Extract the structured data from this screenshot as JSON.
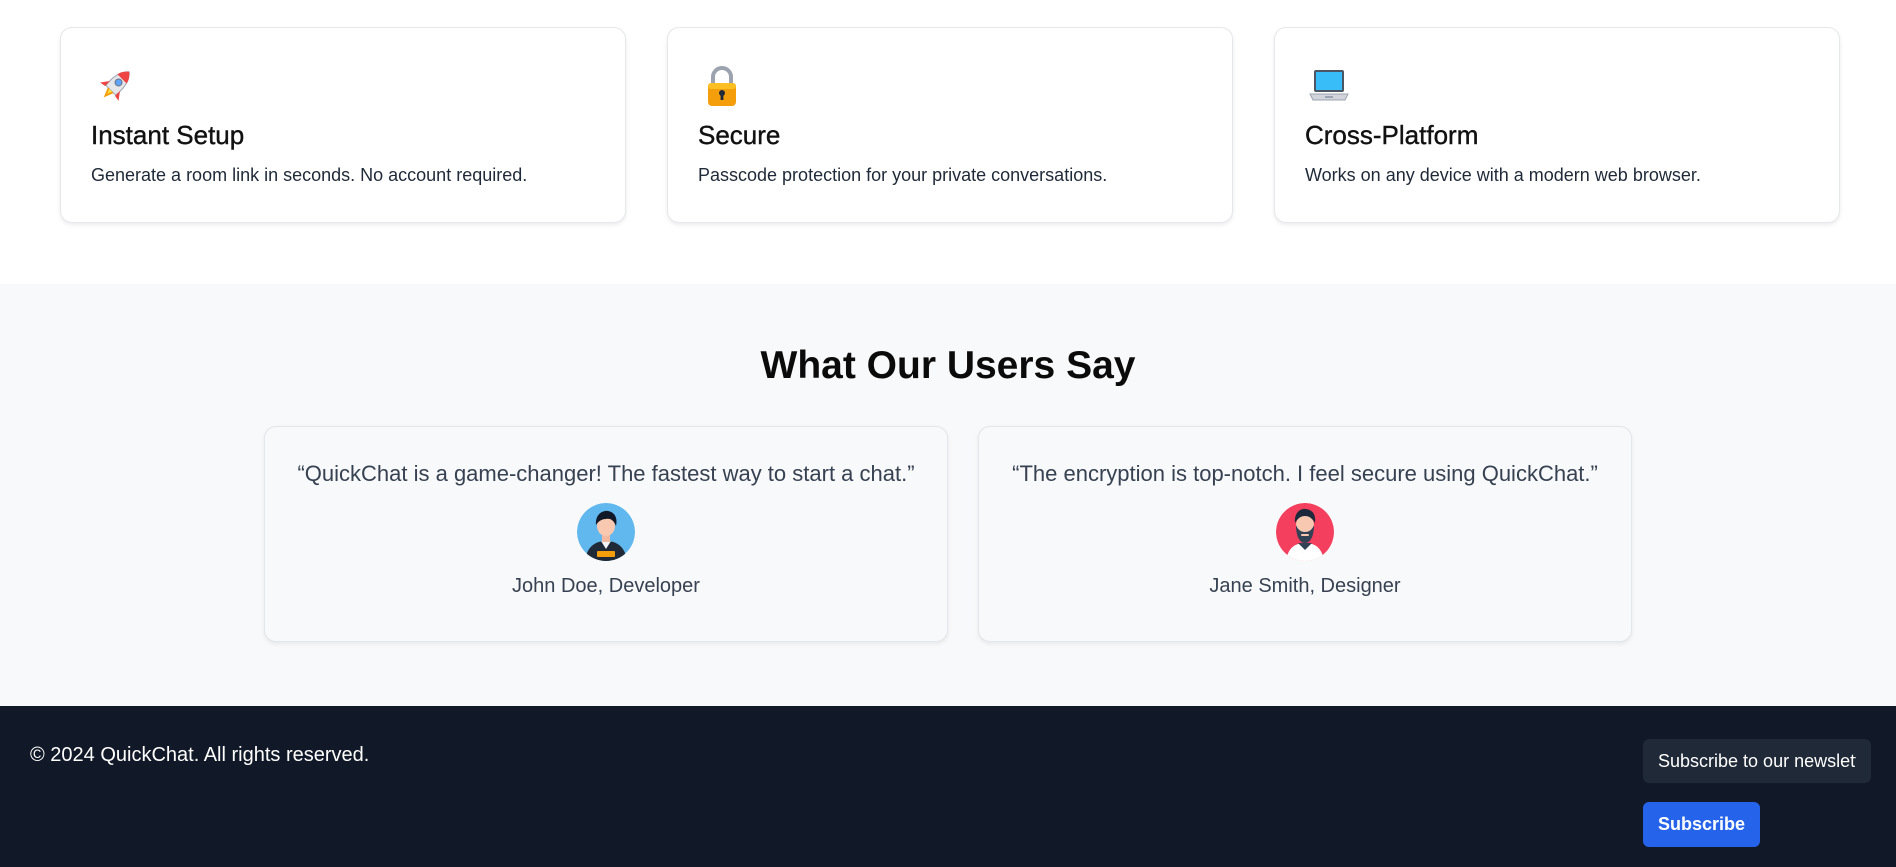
{
  "features": [
    {
      "icon": "rocket-icon",
      "title": "Instant Setup",
      "description": "Generate a room link in seconds. No account required."
    },
    {
      "icon": "lock-icon",
      "title": "Secure",
      "description": "Passcode protection for your private conversations."
    },
    {
      "icon": "laptop-icon",
      "title": "Cross-Platform",
      "description": "Works on any device with a modern web browser."
    }
  ],
  "testimonials": {
    "title": "What Our Users Say",
    "items": [
      {
        "quote": "“QuickChat is a game-changer! The fastest way to start a chat.”",
        "author": "John Doe, Developer",
        "avatar": "developer-avatar"
      },
      {
        "quote": "“The encryption is top-notch. I feel secure using QuickChat.”",
        "author": "Jane Smith, Designer",
        "avatar": "designer-avatar"
      }
    ]
  },
  "footer": {
    "copyright": "© 2024 QuickChat. All rights reserved.",
    "newsletter_placeholder": "Subscribe to our newsletter",
    "subscribe_label": "Subscribe"
  },
  "colors": {
    "footer_bg": "#111827",
    "accent": "#2563eb",
    "section_bg": "#f8f9fa"
  }
}
